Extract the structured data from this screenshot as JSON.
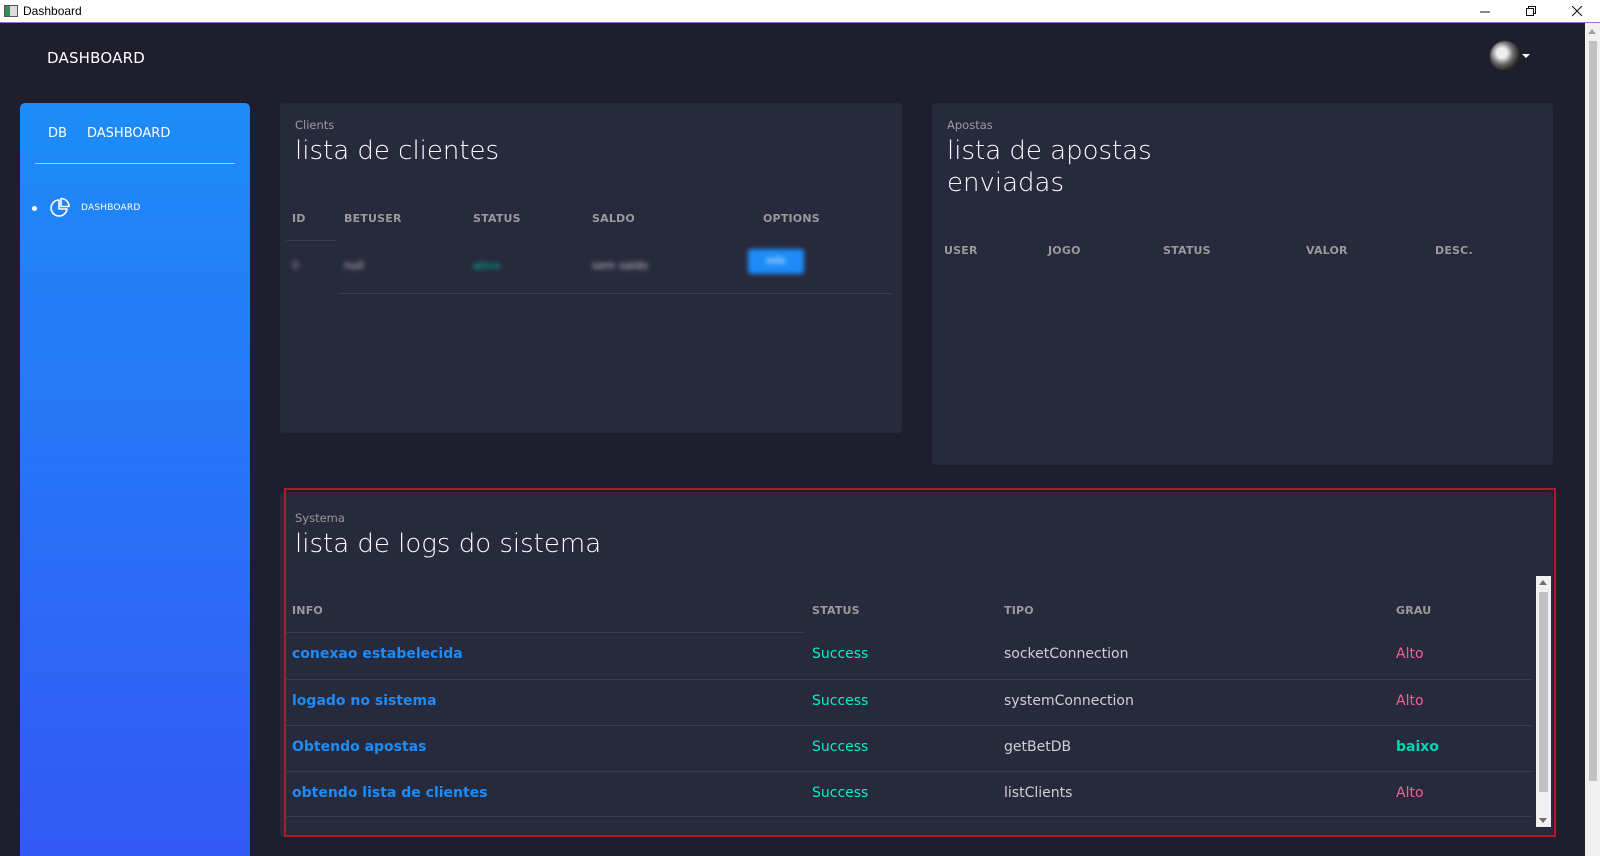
{
  "window": {
    "title": "Dashboard",
    "minimize_glyph": "─",
    "restore_glyph": "❐",
    "close_glyph": "✕"
  },
  "navbar": {
    "brand": "DASHBOARD"
  },
  "sidebar": {
    "mini": "DB",
    "logo": "DASHBOARD",
    "items": [
      {
        "label": "DASHBOARD",
        "icon": "chart-pie-icon"
      }
    ]
  },
  "clients": {
    "category": "Clients",
    "title": "lista de clientes",
    "headers": [
      "ID",
      "BETUSER",
      "STATUS",
      "SALDO",
      "OPTIONS"
    ],
    "rows": [
      {
        "id": "0",
        "betuser": "null",
        "status": "ativo",
        "saldo": "sem saldo",
        "option": "Info"
      }
    ]
  },
  "bets": {
    "category": "Apostas",
    "title_line1": "lista de apostas",
    "title_line2": "enviadas",
    "headers": [
      "USER",
      "JOGO",
      "STATUS",
      "VALOR",
      "DESC."
    ]
  },
  "logs": {
    "category": "Systema",
    "title": "lista de logs do sistema",
    "headers": [
      "INFO",
      "STATUS",
      "TIPO",
      "GRAU"
    ],
    "rows": [
      {
        "info": "conexao estabelecida",
        "status": "Success",
        "tipo": "socketConnection",
        "grau": "Alto"
      },
      {
        "info": "logado no sistema",
        "status": "Success",
        "tipo": "systemConnection",
        "grau": "Alto"
      },
      {
        "info": "Obtendo apostas",
        "status": "Success",
        "tipo": "getBetDB",
        "grau": "baixo"
      },
      {
        "info": "obtendo lista de clientes",
        "status": "Success",
        "tipo": "listClients",
        "grau": "Alto"
      }
    ]
  },
  "colors": {
    "background": "#1e1e2d",
    "card": "#27293d",
    "sidebar_top": "#1d8cf8",
    "sidebar_bottom": "#3358f4",
    "success": "#00f2c3",
    "danger": "#fd5d93",
    "info": "#1d8cf8",
    "highlight_border": "#b0192a"
  }
}
